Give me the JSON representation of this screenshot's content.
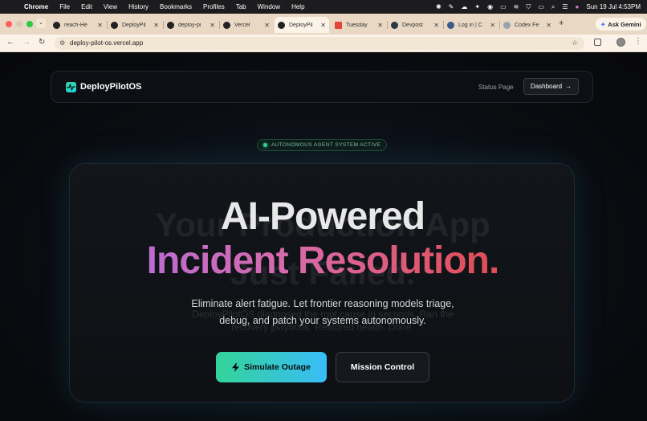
{
  "menubar": {
    "items": [
      "Chrome",
      "File",
      "Edit",
      "View",
      "History",
      "Bookmarks",
      "Profiles",
      "Tab",
      "Window",
      "Help"
    ],
    "clock": "Sun 19 Jul  4:53PM"
  },
  "tabs": [
    {
      "label": "reach-He",
      "icon": "github-icon"
    },
    {
      "label": "DeployPil",
      "icon": "vercel-icon"
    },
    {
      "label": "deploy-pi",
      "icon": "vercel-icon"
    },
    {
      "label": "Vercel",
      "icon": "vercel-icon"
    },
    {
      "label": "DeployPil",
      "icon": "vercel-icon",
      "active": true
    },
    {
      "label": "Tuesday",
      "icon": "gmail-icon"
    },
    {
      "label": "Devpost",
      "icon": "devpost-icon"
    },
    {
      "label": "Log in | C",
      "icon": "login-icon"
    },
    {
      "label": "Codex Fe",
      "icon": "globe-icon"
    }
  ],
  "browser": {
    "url": "deploy-pilot-os.vercel.app",
    "ask_gemini": "Ask Gemini"
  },
  "nav": {
    "brand": "DeployPilotOS",
    "status_link": "Status Page",
    "dashboard_button": "Dashboard",
    "dashboard_arrow": "→"
  },
  "hero": {
    "badge": "AUTONOMOUS AGENT SYSTEM ACTIVE",
    "ghost_line1": "Your Production App",
    "ghost_line2": "Just Failed.",
    "ghost_sub1": "DeployPilotOS diagnosed the root cause in seconds. Ran the",
    "ghost_sub2": "recovery playbook. Restored health. Done.",
    "headline1": "AI-Powered",
    "headline2": "Incident Resolution.",
    "subline1": "Eliminate alert fatigue. Let frontier reasoning models triage,",
    "subline2": "debug, and patch your systems autonomously.",
    "primary_button": "Simulate Outage",
    "secondary_button": "Mission Control"
  },
  "colors": {
    "accent_green": "#34d399",
    "accent_cyan": "#38bdf8",
    "gradient_purple": "#b06ce6",
    "gradient_red": "#d9434f",
    "tabbar": "#e9d9c4"
  }
}
